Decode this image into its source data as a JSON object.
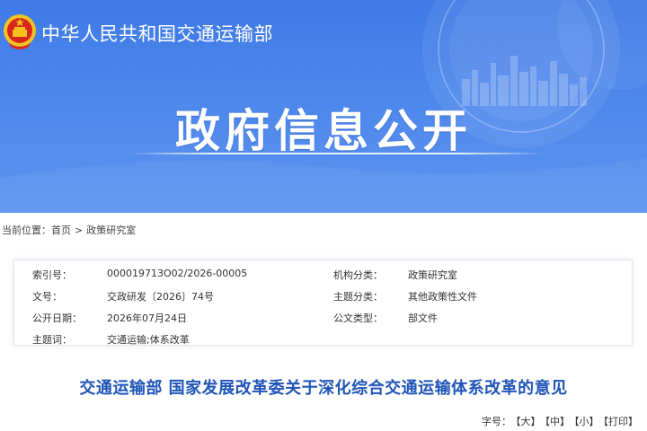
{
  "header": {
    "ministry_name": "中华人民共和国交通运输部",
    "banner_title": "政府信息公开"
  },
  "colors": {
    "banner_blue": "#4a84eb",
    "title_blue": "#1f55b8",
    "emblem_red": "#d9261c",
    "emblem_gold": "#f4c21f"
  },
  "breadcrumb": {
    "label": "当前位置：",
    "home": "首页",
    "separator": ">",
    "current": "政策研究室"
  },
  "info": {
    "index_label": "索引号：",
    "index_value": "000019713O02/2026-00005",
    "category_label": "机构分类：",
    "category_value": "政策研究室",
    "doc_no_label": "文号：",
    "doc_no_value": "交政研发〔2026〕74号",
    "topic_label": "主题分类：",
    "topic_value": "其他政策性文件",
    "date_label": "公开日期：",
    "date_value": "2026年07月24日",
    "type_label": "公文类型：",
    "type_value": "部文件",
    "keywords_label": "主题词：",
    "keywords_value": "交通运输;体系改革"
  },
  "document": {
    "title": "交通运输部 国家发展改革委关于深化综合交通运输体系改革的意见"
  },
  "toolbar": {
    "font_size_label": "字号：",
    "large": "【大】",
    "medium": "【中】",
    "small": "【小】",
    "print": "【打印】"
  },
  "icons": {
    "emblem": "national-emblem-icon"
  }
}
